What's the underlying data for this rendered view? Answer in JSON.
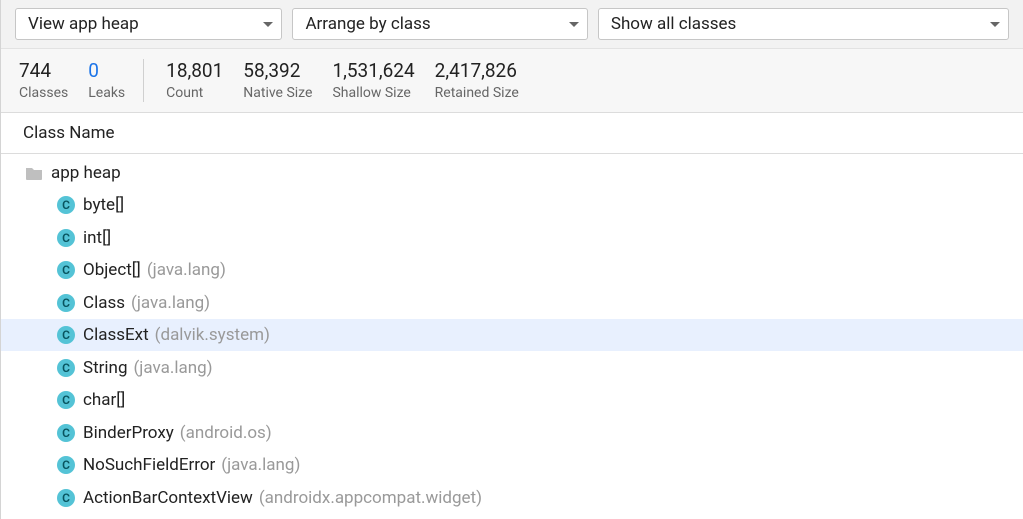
{
  "dropdowns": {
    "heap": {
      "label": "View app heap"
    },
    "arrange": {
      "label": "Arrange by class"
    },
    "filter": {
      "label": "Show all classes"
    }
  },
  "stats": {
    "classes": {
      "value": "744",
      "label": "Classes"
    },
    "leaks": {
      "value": "0",
      "label": "Leaks"
    },
    "count": {
      "value": "18,801",
      "label": "Count"
    },
    "native": {
      "value": "58,392",
      "label": "Native Size"
    },
    "shallow": {
      "value": "1,531,624",
      "label": "Shallow Size"
    },
    "retained": {
      "value": "2,417,826",
      "label": "Retained Size"
    }
  },
  "table": {
    "header": "Class Name"
  },
  "tree": {
    "root": "app heap",
    "class_badge": "C",
    "items": [
      {
        "name": "byte[]",
        "pkg": "",
        "selected": false
      },
      {
        "name": "int[]",
        "pkg": "",
        "selected": false
      },
      {
        "name": "Object[]",
        "pkg": "(java.lang)",
        "selected": false
      },
      {
        "name": "Class",
        "pkg": "(java.lang)",
        "selected": false
      },
      {
        "name": "ClassExt",
        "pkg": "(dalvik.system)",
        "selected": true
      },
      {
        "name": "String",
        "pkg": "(java.lang)",
        "selected": false
      },
      {
        "name": "char[]",
        "pkg": "",
        "selected": false
      },
      {
        "name": "BinderProxy",
        "pkg": "(android.os)",
        "selected": false
      },
      {
        "name": "NoSuchFieldError",
        "pkg": "(java.lang)",
        "selected": false
      },
      {
        "name": "ActionBarContextView",
        "pkg": "(androidx.appcompat.widget)",
        "selected": false
      }
    ]
  }
}
